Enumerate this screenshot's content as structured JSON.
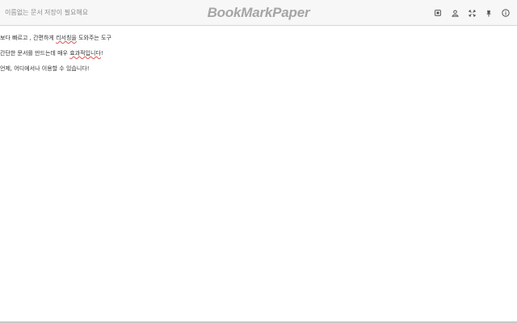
{
  "header": {
    "document_title": "이름없는 문서",
    "save_status": "저장이 필요해요",
    "brand": "BookMarkPaper"
  },
  "toolbar": {
    "icons": [
      "save-icon",
      "user-icon",
      "fullscreen-icon",
      "pin-icon",
      "info-icon"
    ]
  },
  "editor": {
    "lines": [
      {
        "before": "보다 빠르고 , 간편하게 ",
        "flagged": "리서칭을",
        "after": " 도와주는 도구"
      },
      {
        "before": "간단한 문서를 만드는데 매우 ",
        "flagged": "효과적입니다",
        "after": "!"
      },
      {
        "before": "언제, 어디에서나 이용할 수 있습니다!",
        "flagged": "",
        "after": ""
      }
    ]
  },
  "colors": {
    "brand_text": "#a5a5a5",
    "header_bg": "#f7f7f7",
    "muted_text": "#8c8c8c",
    "spellcheck_underline": "#e05050"
  }
}
